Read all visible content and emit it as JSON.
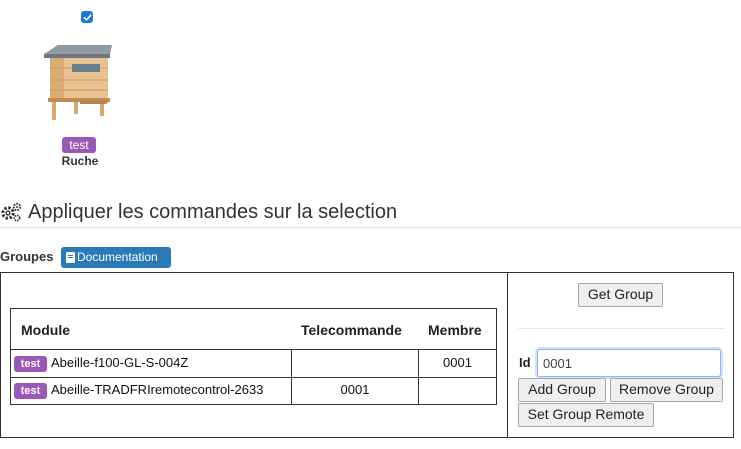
{
  "device_card": {
    "selected": true,
    "badge": "test",
    "name": "Ruche",
    "image": "beehive-image"
  },
  "section": {
    "icon": "gears-icon",
    "title": "Appliquer les commandes sur la selection"
  },
  "groups": {
    "label": "Groupes",
    "documentation_label": "Documentation",
    "documentation_icon": "book-icon"
  },
  "table": {
    "headers": [
      "Module",
      "Telecommande",
      "Membre"
    ],
    "rows": [
      {
        "badge": "test",
        "module": "Abeille-f100-GL-S-004Z",
        "telecommande": "",
        "membre": "0001"
      },
      {
        "badge": "test",
        "module": "Abeille-TRADFRIremotecontrol-2633",
        "telecommande": "0001",
        "membre": ""
      }
    ]
  },
  "panel": {
    "get_group_label": "Get Group",
    "id_label": "Id",
    "id_value": "0001",
    "add_group_label": "Add Group",
    "remove_group_label": "Remove Group",
    "set_group_remote_label": "Set Group Remote"
  },
  "colors": {
    "badge": "#9b59b6",
    "documentation_button": "#2a7ab8",
    "checkbox": "#1e7ad8"
  }
}
